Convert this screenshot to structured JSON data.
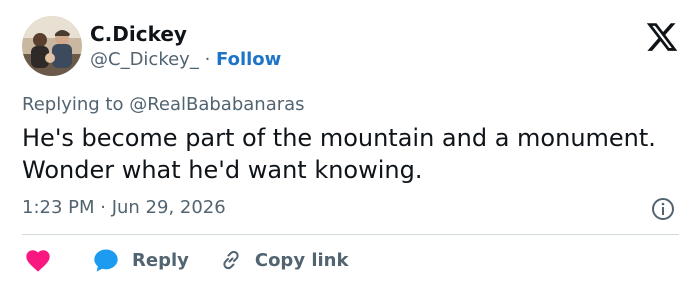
{
  "author": {
    "display_name": "C.Dickey",
    "handle": "@C_Dickey_",
    "separator": " · ",
    "follow_label": "Follow"
  },
  "reply": {
    "prefix": "Replying to ",
    "target": "@RealBababanaras"
  },
  "tweet": {
    "text": "He's become part of the mountain and a monument. Wonder what he'd want knowing.",
    "timestamp": "1:23 PM · Jun 29, 2026"
  },
  "actions": {
    "reply_label": "Reply",
    "copy_label": "Copy link"
  },
  "icons": {
    "logo": "x-logo-icon",
    "info": "info-icon",
    "like": "heart-icon",
    "reply": "reply-bubble-icon",
    "copy": "link-icon"
  },
  "colors": {
    "follow": "#1d74c8",
    "heart": "#f91880",
    "reply_bubble": "#1d9bf0",
    "secondary_text": "#536471"
  }
}
